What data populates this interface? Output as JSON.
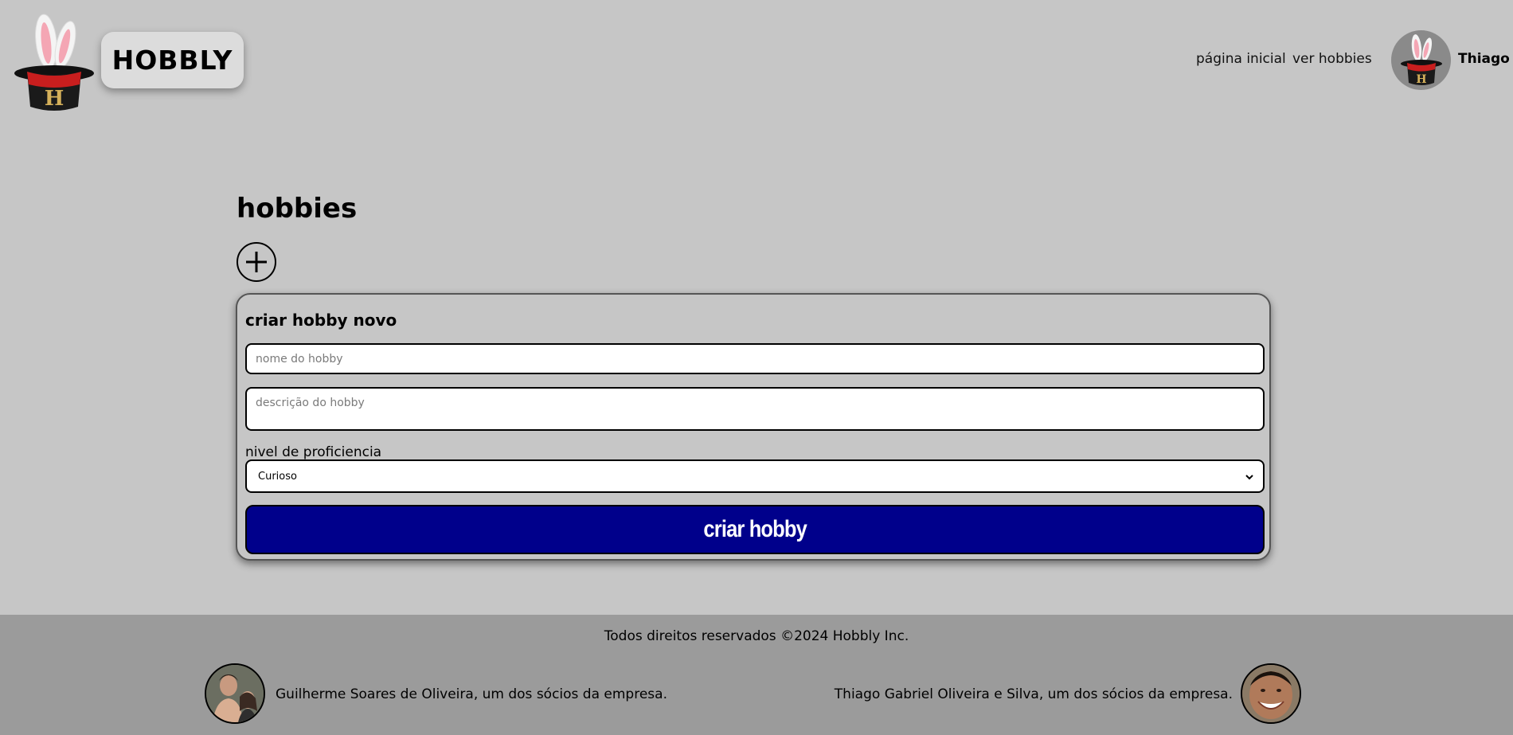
{
  "header": {
    "brand": "HOBBLY",
    "nav": {
      "home": "página inicial",
      "hobbies": "ver hobbies"
    },
    "user": {
      "name": "Thiago"
    },
    "logo_icon": "magic-hat-bunny-icon"
  },
  "main": {
    "title": "hobbies",
    "add_icon": "plus-icon",
    "form": {
      "title": "criar hobby novo",
      "name_placeholder": "nome do hobby",
      "description_placeholder": "descrição do hobby",
      "level_label": "nivel de proficiencia",
      "level_selected": "Curioso",
      "submit_label": "criar hobby"
    }
  },
  "footer": {
    "copyright": "Todos direitos reservados ©2024 Hobbly Inc.",
    "partners": [
      {
        "text": "Guilherme Soares de Oliveira, um dos sócios da empresa."
      },
      {
        "text": "Thiago Gabriel Oliveira e Silva, um dos sócios da empresa."
      }
    ]
  },
  "colors": {
    "background": "#c6c6c6",
    "footer": "#9b9b9b",
    "submit_button": "#00008b",
    "brand_box": "#dcdcdc"
  }
}
